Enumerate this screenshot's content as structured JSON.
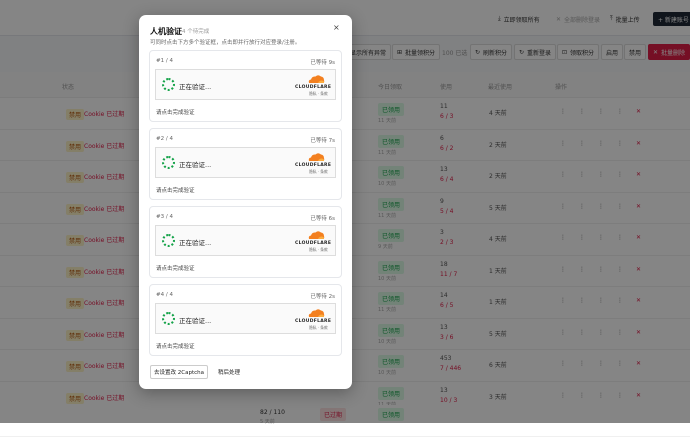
{
  "topbar": {
    "buttons": [
      {
        "label": "立即领取所有"
      },
      {
        "label": "全部删除登录"
      },
      {
        "label": "批量上传"
      },
      {
        "label": "+ 新建账号"
      }
    ]
  },
  "toolbar": {
    "buttons": [
      {
        "label": "显示所有异常"
      },
      {
        "label": "批量领积分"
      },
      {
        "label": "100 已选"
      },
      {
        "label": "刷新积分"
      },
      {
        "label": "重新登录"
      },
      {
        "label": "领取积分"
      },
      {
        "label": "启用"
      },
      {
        "label": "禁用"
      },
      {
        "label": "批量删除"
      }
    ]
  },
  "table": {
    "headers": [
      "状态",
      "今日领取",
      "使用",
      "最近使用",
      "操作"
    ],
    "rows": [
      {
        "ban": "禁用",
        "status": "Cookie 已过期",
        "today": "已领用",
        "today_sub": "11 天前",
        "usage_top": "11",
        "usage_bottom": "6 / 3",
        "recent": "4 天前"
      },
      {
        "ban": "禁用",
        "status": "Cookie 已过期",
        "today": "已领用",
        "today_sub": "11 天前",
        "usage_top": "6",
        "usage_bottom": "6 / 2",
        "recent": "2 天前"
      },
      {
        "ban": "禁用",
        "status": "Cookie 已过期",
        "today": "已领用",
        "today_sub": "10 天前",
        "usage_top": "13",
        "usage_bottom": "6 / 4",
        "recent": "2 天前"
      },
      {
        "ban": "禁用",
        "status": "Cookie 已过期",
        "today": "已领用",
        "today_sub": "11 天前",
        "usage_top": "9",
        "usage_bottom": "5 / 4",
        "recent": "5 天前"
      },
      {
        "ban": "禁用",
        "status": "Cookie 已过期",
        "today": "已领用",
        "today_sub": "9 天前",
        "usage_top": "3",
        "usage_bottom": "2 / 3",
        "recent": "4 天前"
      },
      {
        "ban": "禁用",
        "status": "Cookie 已过期",
        "today": "已领用",
        "today_sub": "10 天前",
        "usage_top": "18",
        "usage_bottom": "11 / 7",
        "recent": "1 天前"
      },
      {
        "ban": "禁用",
        "status": "Cookie 已过期",
        "today": "已领用",
        "today_sub": "11 天前",
        "usage_top": "14",
        "usage_bottom": "6 / 5",
        "recent": "1 天前"
      },
      {
        "ban": "禁用",
        "status": "Cookie 已过期",
        "today": "已领用",
        "today_sub": "10 天前",
        "usage_top": "13",
        "usage_bottom": "3 / 6",
        "recent": "5 天前"
      },
      {
        "ban": "禁用",
        "status": "Cookie 已过期",
        "today": "已领用",
        "today_sub": "10 天前",
        "usage_top": "453",
        "usage_bottom": "7 / 446",
        "recent": "6 天前"
      },
      {
        "ban": "禁用",
        "status": "Cookie 已过期",
        "today": "已领用",
        "today_sub": "11 天前",
        "usage_top": "13",
        "usage_bottom": "10 / 3",
        "recent": "3 天前"
      }
    ],
    "partial_row": {
      "points": "82 / 110",
      "points_sub": "5 天前",
      "badge": "已过期",
      "today": "已领用"
    }
  },
  "modal": {
    "title": "人机验证",
    "count": "4 个待完成",
    "close": "×",
    "desc": "可同时点击下方多个验证框，点击即并行放行对应登录/注册。",
    "cards": [
      {
        "idx": "#1 / 4",
        "wait": "已等待 9s",
        "text": "正在验证...",
        "hint": "请点击完成验证"
      },
      {
        "idx": "#2 / 4",
        "wait": "已等待 7s",
        "text": "正在验证...",
        "hint": "请点击完成验证"
      },
      {
        "idx": "#3 / 4",
        "wait": "已等待 6s",
        "text": "正在验证...",
        "hint": "请点击完成验证"
      },
      {
        "idx": "#4 / 4",
        "wait": "已等待 2s",
        "text": "正在验证...",
        "hint": "请点击完成验证"
      }
    ],
    "cf_word": "CLOUDFLARE",
    "cf_links": "隐私 · 条款",
    "footer": {
      "primary": "去设置改 2Captcha",
      "secondary": "稍后处理"
    }
  },
  "colors": {
    "accent_red": "#e11d48",
    "green": "#16a34a",
    "cloudflare_orange": "#f38020"
  }
}
